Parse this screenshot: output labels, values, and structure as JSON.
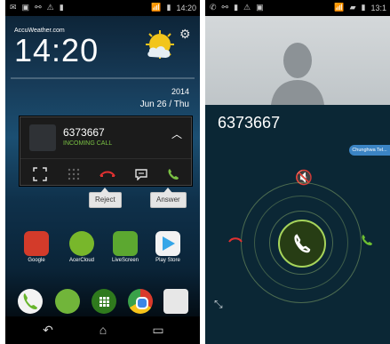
{
  "left_phone": {
    "status_bar": {
      "time": "14:20",
      "left_icons": [
        "notification-icon",
        "image-icon",
        "usb-icon",
        "warning-icon",
        "sim-icon"
      ],
      "right_icons": [
        "wifi-icon",
        "battery-icon"
      ]
    },
    "widget": {
      "brand": "AccuWeather.com",
      "clock": "14:20",
      "year": "2014",
      "date": "Jun 26 / Thu",
      "weather_icon": "sun-cloud-icon",
      "settings_icon": "gear-icon"
    },
    "call_popup": {
      "number": "6373667",
      "status": "INCOMING CALL",
      "actions": [
        {
          "name": "expand",
          "icon": "expand-icon"
        },
        {
          "name": "keypad",
          "icon": "dialpad-icon"
        },
        {
          "name": "reject",
          "icon": "end-call-icon"
        },
        {
          "name": "message",
          "icon": "message-icon"
        },
        {
          "name": "answer",
          "icon": "call-icon"
        }
      ],
      "tooltip_reject": "Reject",
      "tooltip_answer": "Answer"
    },
    "apps": [
      {
        "label": "Google",
        "icon": "google-folder-icon"
      },
      {
        "label": "AcerCloud",
        "icon": "cloud-icon"
      },
      {
        "label": "LiveScreen",
        "icon": "livescreen-icon"
      },
      {
        "label": "Play Store",
        "icon": "play-store-icon"
      }
    ],
    "dock": [
      {
        "icon": "phone-icon"
      },
      {
        "icon": "messaging-icon"
      },
      {
        "icon": "app-drawer-icon"
      },
      {
        "icon": "chrome-icon"
      },
      {
        "icon": "camera-icon"
      }
    ],
    "nav": [
      "back-icon",
      "home-icon",
      "recent-apps-icon"
    ]
  },
  "right_phone": {
    "status_bar": {
      "time": "13:1",
      "left_icons": [
        "call-icon",
        "usb-icon",
        "sim-icon",
        "warning-icon",
        "image-icon"
      ],
      "right_icons": [
        "wifi-icon",
        "signal-icon",
        "battery-icon"
      ]
    },
    "caller_number": "6373667",
    "carrier": "Chunghwa Tel...",
    "mute_icon": "speaker-mute-icon",
    "answer_icon": "call-icon",
    "reject_icon": "end-call-icon",
    "accept_small_icon": "call-icon",
    "shrink_icon": "collapse-icon"
  },
  "colors": {
    "accent_green": "#7ac143",
    "reject_red": "#e03131",
    "answer_ring": "#a6d45b",
    "carrier_pill": "#3b84c4"
  }
}
